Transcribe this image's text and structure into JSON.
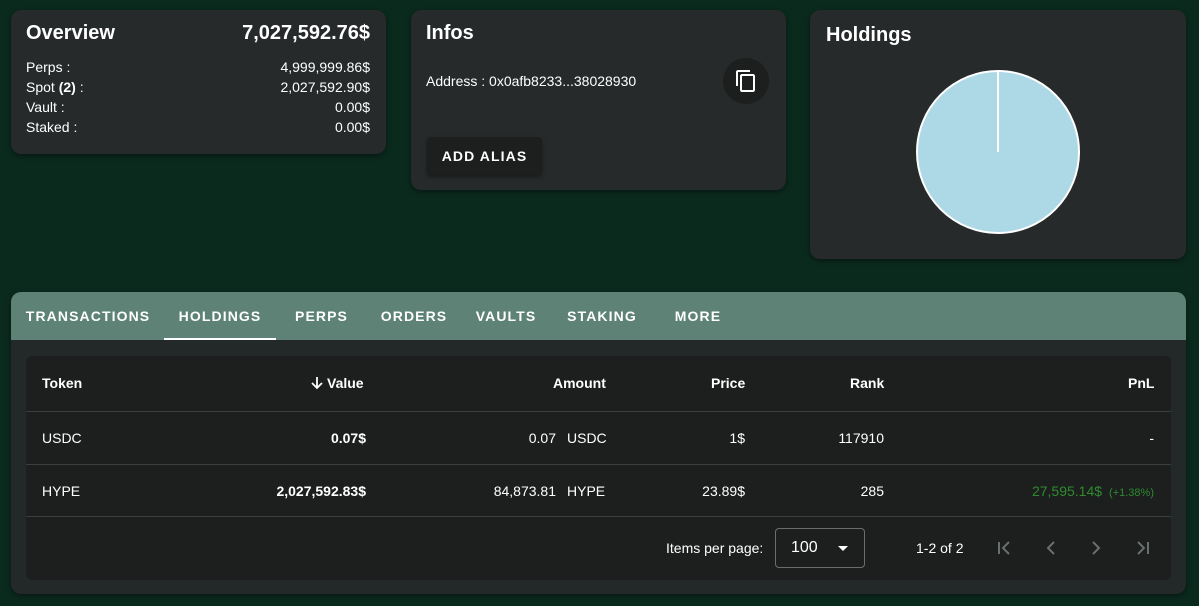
{
  "overview": {
    "title": "Overview",
    "total": "7,027,592.76$",
    "rows": [
      {
        "label": "Perps :",
        "value": "4,999,999.86$"
      },
      {
        "label_prefix": "Spot ",
        "label_bold": "(2)",
        "label_suffix": " :",
        "value": "2,027,592.90$"
      },
      {
        "label": "Vault :",
        "value": "0.00$"
      },
      {
        "label": "Staked :",
        "value": "0.00$"
      }
    ]
  },
  "infos": {
    "title": "Infos",
    "address": "Address : 0x0afb8233...38028930",
    "alias_button": "ADD ALIAS",
    "copy_icon": "copy-icon"
  },
  "holdings_card": {
    "title": "Holdings",
    "pie_color": "#add8e6",
    "chart_data": {
      "type": "pie",
      "slices": [
        {
          "label": "HYPE",
          "value": 2027592.83
        },
        {
          "label": "USDC",
          "value": 0.07
        }
      ]
    }
  },
  "tabs": [
    {
      "label": "TRANSACTIONS"
    },
    {
      "label": "HOLDINGS",
      "active": true
    },
    {
      "label": "PERPS"
    },
    {
      "label": "ORDERS"
    },
    {
      "label": "VAULTS"
    },
    {
      "label": "STAKING"
    },
    {
      "label": "MORE"
    }
  ],
  "table": {
    "headers": {
      "token": "Token",
      "value": "Value",
      "amount": "Amount",
      "price": "Price",
      "rank": "Rank",
      "pnl": "PnL"
    },
    "sort_icon": "arrow-down-icon",
    "rows": [
      {
        "token": "USDC",
        "value": "0.07$",
        "amount": "0.07",
        "amount_token": "USDC",
        "price": "1$",
        "rank": "117910",
        "pnl": "-",
        "pnl_pct": ""
      },
      {
        "token": "HYPE",
        "value": "2,027,592.83$",
        "amount": "84,873.81",
        "amount_token": "HYPE",
        "price": "23.89$",
        "rank": "285",
        "pnl": "27,595.14$",
        "pnl_pct": "(+1.38%)"
      }
    ]
  },
  "pagination": {
    "items_per_page_label": "Items per page:",
    "items_per_page_value": "100",
    "range": "1-2 of 2"
  },
  "colors": {
    "background": "#0b2a1e",
    "card": "#262a2a",
    "tabbar": "#5e8276",
    "positive": "#2e8b2e"
  }
}
